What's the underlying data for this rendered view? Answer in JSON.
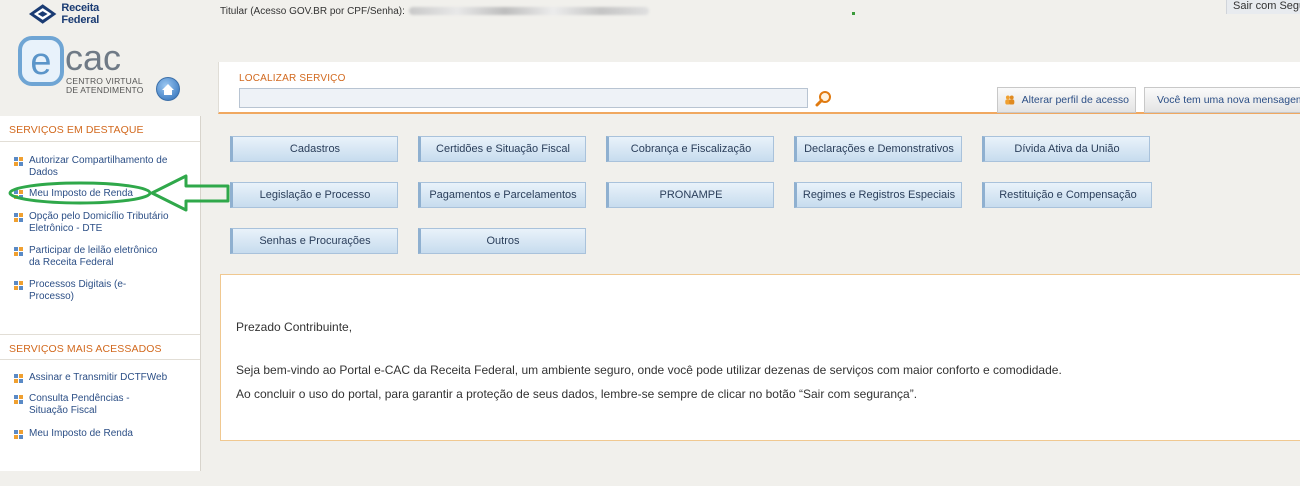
{
  "header": {
    "org_name": "Receita Federal",
    "titular_text": "Titular (Acesso GOV.BR por CPF/Senha):",
    "sair_label": "Sair com Segurança"
  },
  "logo": {
    "brand": "ecac",
    "subtitle_line1": "CENTRO VIRTUAL",
    "subtitle_line2": "DE ATENDIMENTO"
  },
  "search": {
    "label": "LOCALIZAR SERVIÇO",
    "value": ""
  },
  "top_buttons": {
    "perfil_label": "Alterar perfil de acesso",
    "mensagem_label": "Você tem uma nova mensagem"
  },
  "sidebar": {
    "destaque_title": "SERVIÇOS EM DESTAQUE",
    "destaque_items": [
      {
        "line1": "Autorizar Compartilhamento de",
        "line2": "Dados"
      },
      {
        "line1": "Meu Imposto de Renda",
        "line2": ""
      },
      {
        "line1": "Opção pelo Domicílio Tributário",
        "line2": "Eletrônico - DTE"
      },
      {
        "line1": "Participar de leilão eletrônico",
        "line2": "da Receita Federal"
      },
      {
        "line1": "Processos Digitais (e-",
        "line2": "Processo)"
      }
    ],
    "acessados_title": "SERVIÇOS MAIS ACESSADOS",
    "acessados_items": [
      {
        "line1": "Assinar e Transmitir DCTFWeb",
        "line2": ""
      },
      {
        "line1": "Consulta Pendências -",
        "line2": "Situação Fiscal"
      },
      {
        "line1": "Meu Imposto de Renda",
        "line2": ""
      }
    ]
  },
  "categories": [
    "Cadastros",
    "Certidões e Situação Fiscal",
    "Cobrança e Fiscalização",
    "Declarações e Demonstrativos",
    "Dívida Ativa da União",
    "Legislação e Processo",
    "Pagamentos e Parcelamentos",
    "PRONAMPE",
    "Regimes e Registros Especiais",
    "Restituição e Compensação",
    "Senhas e Procurações",
    "Outros"
  ],
  "welcome": {
    "greeting": "Prezado Contribuinte,",
    "line1": "Seja bem-vindo ao Portal e-CAC da Receita Federal, um ambiente seguro, onde você pode utilizar dezenas de serviços com maior conforto e comodidade.",
    "line2": "Ao concluir o uso do portal, para garantir a proteção de seus dados, lembre-se sempre de clicar no botão “Sair com segurança”."
  },
  "colors": {
    "accent_orange": "#d2691e",
    "link_blue": "#2c4f86",
    "annotation_green": "#2fa84a"
  }
}
